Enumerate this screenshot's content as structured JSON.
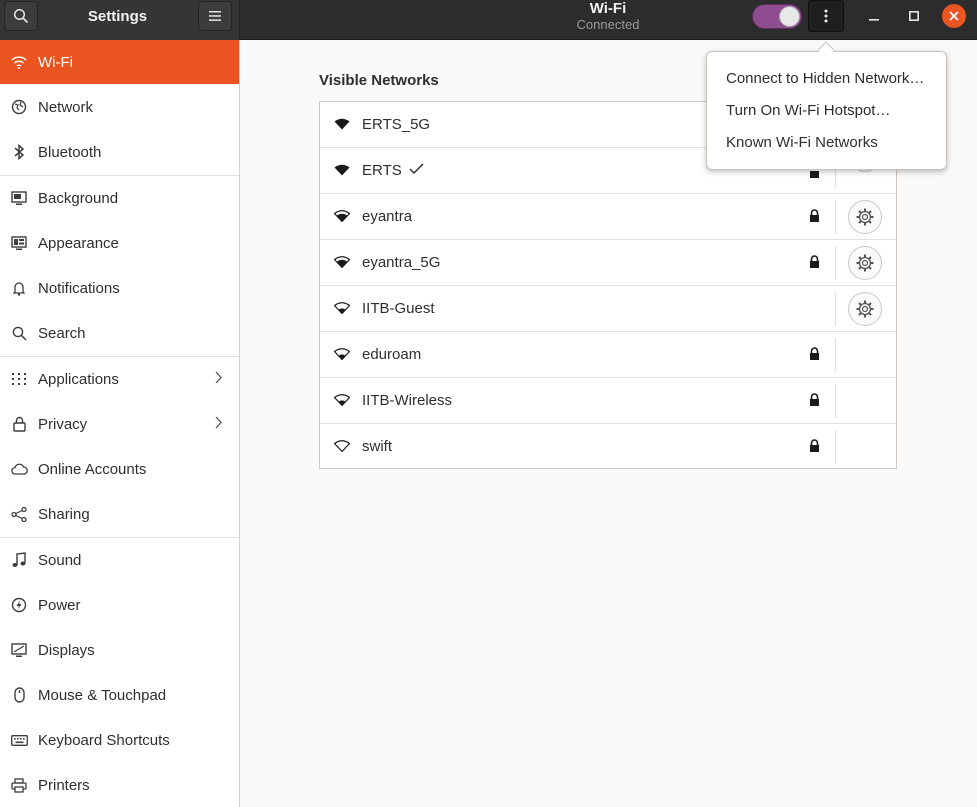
{
  "sidebar_header": {
    "title": "Settings"
  },
  "header": {
    "title": "Wi-Fi",
    "subtitle": "Connected",
    "wifi_enabled": true
  },
  "sidebar": {
    "items": [
      {
        "label": "Wi-Fi",
        "icon": "wifi-icon",
        "active": true
      },
      {
        "label": "Network",
        "icon": "network-icon"
      },
      {
        "label": "Bluetooth",
        "icon": "bluetooth-icon"
      },
      {
        "label": "Background",
        "icon": "background-icon"
      },
      {
        "label": "Appearance",
        "icon": "appearance-icon"
      },
      {
        "label": "Notifications",
        "icon": "bell-icon"
      },
      {
        "label": "Search",
        "icon": "search-icon"
      },
      {
        "label": "Applications",
        "icon": "grid-icon",
        "has_submenu": true
      },
      {
        "label": "Privacy",
        "icon": "lock-icon",
        "has_submenu": true
      },
      {
        "label": "Online Accounts",
        "icon": "cloud-icon"
      },
      {
        "label": "Sharing",
        "icon": "share-icon"
      },
      {
        "label": "Sound",
        "icon": "music-note-icon"
      },
      {
        "label": "Power",
        "icon": "power-icon"
      },
      {
        "label": "Displays",
        "icon": "display-icon"
      },
      {
        "label": "Mouse & Touchpad",
        "icon": "mouse-icon"
      },
      {
        "label": "Keyboard Shortcuts",
        "icon": "keyboard-icon"
      },
      {
        "label": "Printers",
        "icon": "printer-icon"
      }
    ]
  },
  "main": {
    "section_title": "Visible Networks",
    "networks": [
      {
        "name": "ERTS_5G",
        "signal": "full",
        "locked": true,
        "connected": false,
        "configurable": true
      },
      {
        "name": "ERTS",
        "signal": "full",
        "locked": true,
        "connected": true,
        "configurable": true
      },
      {
        "name": "eyantra",
        "signal": "good",
        "locked": true,
        "connected": false,
        "configurable": true
      },
      {
        "name": "eyantra_5G",
        "signal": "good",
        "locked": true,
        "connected": false,
        "configurable": true
      },
      {
        "name": "IITB-Guest",
        "signal": "ok",
        "locked": false,
        "connected": false,
        "configurable": true
      },
      {
        "name": "eduroam",
        "signal": "ok",
        "locked": true,
        "connected": false,
        "configurable": false
      },
      {
        "name": "IITB-Wireless",
        "signal": "ok",
        "locked": true,
        "connected": false,
        "configurable": false
      },
      {
        "name": "swift",
        "signal": "weak",
        "locked": true,
        "connected": false,
        "configurable": false
      }
    ]
  },
  "popover": {
    "items": [
      {
        "label": "Connect to Hidden Network…"
      },
      {
        "label": "Turn On Wi-Fi Hotspot…"
      },
      {
        "label": "Known Wi-Fi Networks"
      }
    ]
  },
  "colors": {
    "accent": "#e95420",
    "toggle": "#8e4d8f",
    "header": "#2c2c2c"
  }
}
